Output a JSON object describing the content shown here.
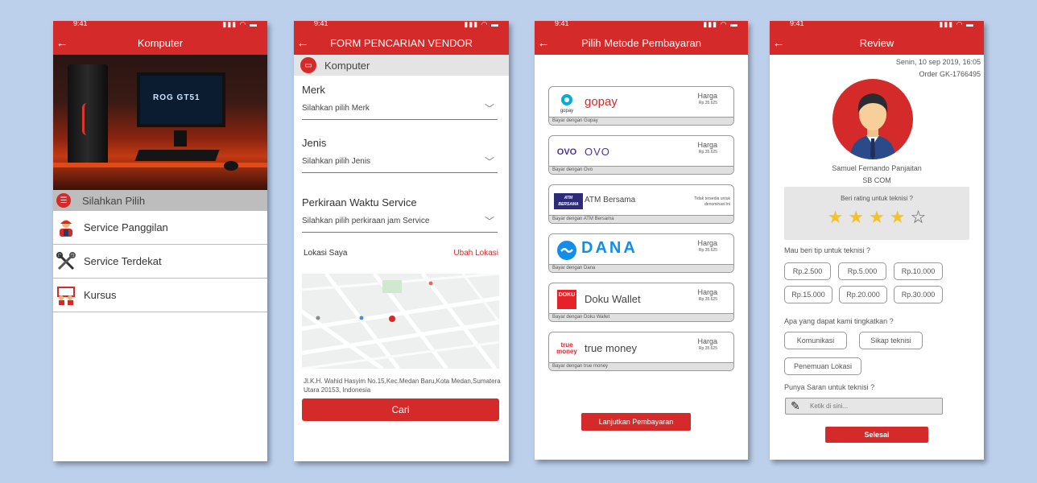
{
  "status": {
    "time": "9:41"
  },
  "screen1": {
    "title": "Komputer",
    "monitor_text": "ROG GT51",
    "choose_label": "Silahkan Pilih",
    "items": [
      {
        "label": "Service Panggilan",
        "icon": "technician-icon"
      },
      {
        "label": "Service Terdekat",
        "icon": "tools-icon"
      },
      {
        "label": "Kursus",
        "icon": "classroom-icon"
      }
    ]
  },
  "screen2": {
    "title": "FORM PENCARIAN VENDOR",
    "category": "Komputer",
    "fields": [
      {
        "label": "Merk",
        "placeholder": "Silahkan pilih Merk"
      },
      {
        "label": "Jenis",
        "placeholder": "Silahkan pilih Jenis"
      },
      {
        "label": "Perkiraan Waktu Service",
        "placeholder": "Silahkan pilih perkiraan jam Service"
      }
    ],
    "location_label": "Lokasi Saya",
    "change_location": "Ubah Lokasi",
    "address": "Jl.K.H. Wahid Hasyim No.15,Kec.Medan Baru,Kota Medan,Sumatera Utara 20153, Indonesia",
    "search_button": "Cari"
  },
  "screen3": {
    "title": "Pilih Metode Pembayaran",
    "methods": [
      {
        "name": "gopay",
        "logo_text": "gopay",
        "harga": "Harga",
        "amount": "Rp.35.625",
        "footer": "Bayar dengan Gopay",
        "accent": "#d42a2a"
      },
      {
        "name": "OVO",
        "logo_text": "OVO",
        "harga": "Harga",
        "amount": "Rp.35.625",
        "footer": "Bayar dengan Ovo",
        "accent": "#4c3494"
      },
      {
        "name": "ATM Bersama",
        "logo_text": "ATM BERSAMA",
        "note": "Tidak tersedia untuk denominasi ini",
        "footer": "Bayar dengan ATM Bersama",
        "accent": "#2b2b7a"
      },
      {
        "name": "DANA",
        "logo_text": "DANA",
        "harga": "Harga",
        "amount": "Rp.35.625",
        "footer": "Bayar dengan Dana",
        "accent": "#118ee9"
      },
      {
        "name": "Doku Wallet",
        "logo_text": "DOKU",
        "harga": "Harga",
        "amount": "Rp.35.625",
        "footer": "Bayar dengan Doku Wallet",
        "accent": "#e52228"
      },
      {
        "name": "true money",
        "logo_text": "true money",
        "harga": "Harga",
        "amount": "Rp.35.625",
        "footer": "Bayar dengan true money",
        "accent": "#f26522"
      }
    ],
    "continue_button": "Lanjutkan Pembayaran"
  },
  "screen4": {
    "title": "Review",
    "date": "Senin, 10 sep 2019, 16:05",
    "order": "Order GK-1766495",
    "name": "Samuel Fernando Panjaitan",
    "company": "SB COM",
    "rating_question": "Beri rating untuk teknisi ?",
    "rating": 4,
    "rating_max": 5,
    "tip_question": "Mau beri tip untuk teknisi ?",
    "tips": [
      "Rp.2.500",
      "Rp.5.000",
      "Rp.10.000",
      "Rp.15.000",
      "Rp.20.000",
      "Rp.30.000"
    ],
    "improve_question": "Apa yang dapat kami tingkatkan ?",
    "improve_options": [
      "Komunikasi",
      "Sikap teknisi",
      "Penemuan Lokasi"
    ],
    "suggest_question": "Punya Saran untuk teknisi ?",
    "suggest_placeholder": "Ketik di sini...",
    "finish_button": "Selesai"
  },
  "colors": {
    "primary": "#d42a2a",
    "background": "#bcd0ec",
    "star": "#f3c22b"
  }
}
